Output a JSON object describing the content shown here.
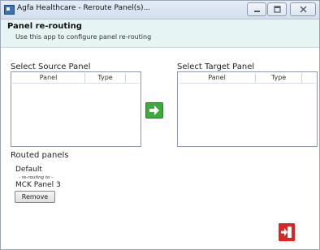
{
  "window": {
    "title": "Agfa Healthcare - Reroute Panel(s)..."
  },
  "header": {
    "title": "Panel re-routing",
    "subtitle": "Use this app to configure panel re-routing"
  },
  "source": {
    "label": "Select Source Panel",
    "columns": [
      "Panel",
      "Type"
    ]
  },
  "target": {
    "label": "Select Target Panel",
    "columns": [
      "Panel",
      "Type"
    ]
  },
  "routed": {
    "label": "Routed panels",
    "items": [
      {
        "source": "Default",
        "connector": "- re-routing to -",
        "target": "MCK Panel 3",
        "remove_label": "Remove"
      }
    ]
  },
  "icons": {
    "app": "app-window-icon",
    "move": "arrow-right-icon",
    "exit": "exit-door-icon"
  },
  "colors": {
    "header_bg": "#e6f5f4",
    "move_button": "#3cab3c",
    "exit_button": "#e02421"
  }
}
